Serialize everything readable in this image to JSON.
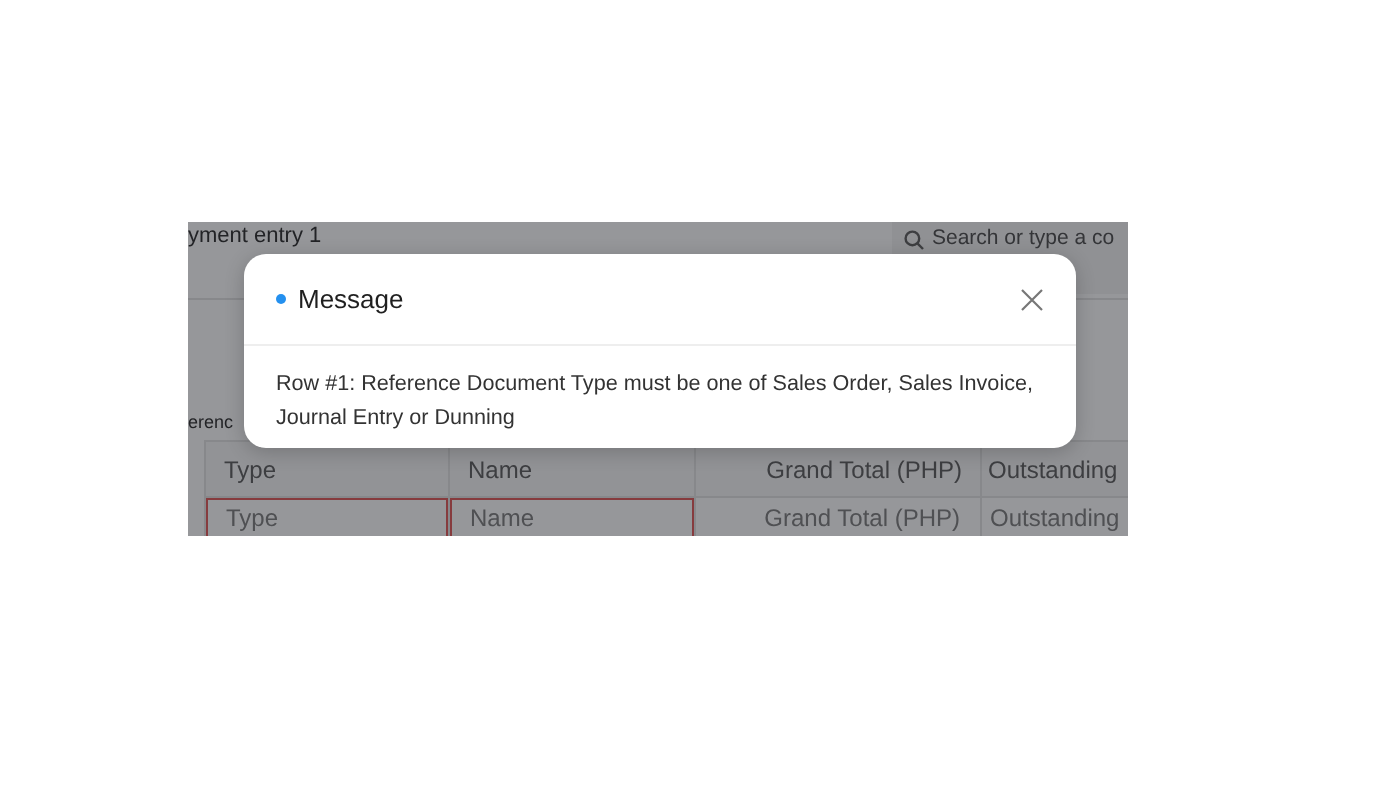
{
  "background": {
    "breadcrumb": "yment entry 1",
    "search": {
      "placeholder": "Search or type a co"
    },
    "section_label": "erenc",
    "table": {
      "columns": [
        {
          "label": "Type"
        },
        {
          "label": "Name"
        },
        {
          "label": "Grand Total (PHP)"
        },
        {
          "label": "Outstanding"
        }
      ],
      "rows": [
        {
          "cells": [
            {
              "placeholder": "Type",
              "invalid": true
            },
            {
              "placeholder": "Name",
              "invalid": true
            },
            {
              "placeholder": "Grand Total (PHP)",
              "invalid": false
            },
            {
              "placeholder": "Outstanding",
              "invalid": false
            }
          ]
        }
      ]
    }
  },
  "dialog": {
    "title": "Message",
    "message": "Row #1: Reference Document Type must be one of Sales Order, Sales Invoice, Journal Entry or Dunning"
  }
}
